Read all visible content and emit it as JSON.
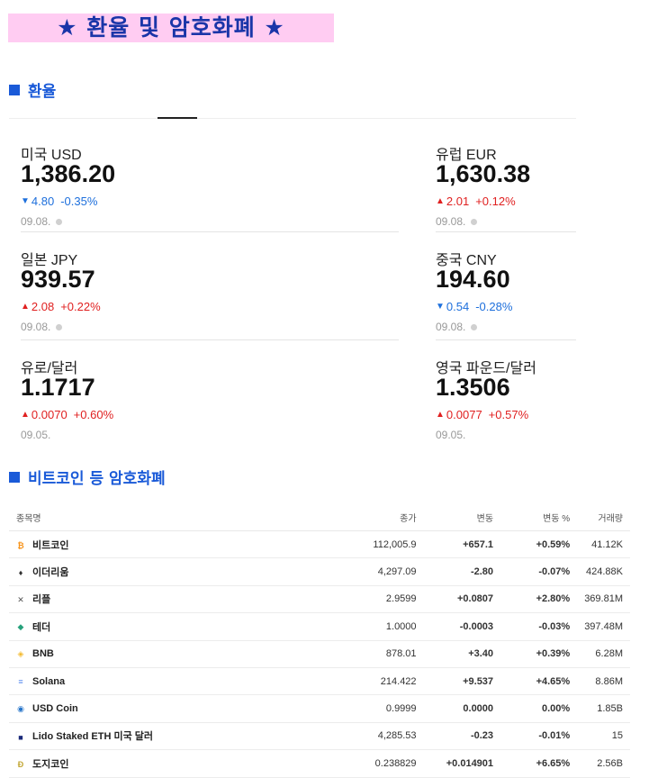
{
  "banner": {
    "title": "★  환율  및  암호화폐 ★"
  },
  "fx_section": {
    "title": "환율",
    "cards": [
      {
        "name": "미국 USD",
        "price": "1,386.20",
        "dir": "down",
        "arrow": "▼",
        "change": "4.80",
        "pct": "-0.35%",
        "date": "09.08.",
        "dot": true
      },
      {
        "name": "유럽 EUR",
        "price": "1,630.38",
        "dir": "up",
        "arrow": "▲",
        "change": "2.01",
        "pct": "+0.12%",
        "date": "09.08.",
        "dot": true
      },
      {
        "name": "일본 JPY",
        "price": "939.57",
        "dir": "up",
        "arrow": "▲",
        "change": "2.08",
        "pct": "+0.22%",
        "date": "09.08.",
        "dot": true
      },
      {
        "name": "중국 CNY",
        "price": "194.60",
        "dir": "down",
        "arrow": "▼",
        "change": "0.54",
        "pct": "-0.28%",
        "date": "09.08.",
        "dot": true
      },
      {
        "name": "유로/달러",
        "price": "1.1717",
        "dir": "up",
        "arrow": "▲",
        "change": "0.0070",
        "pct": "+0.60%",
        "date": "09.05.",
        "dot": false
      },
      {
        "name": "영국 파운드/달러",
        "price": "1.3506",
        "dir": "up",
        "arrow": "▲",
        "change": "0.0077",
        "pct": "+0.57%",
        "date": "09.05.",
        "dot": false
      }
    ]
  },
  "crypto_section": {
    "title": "비트코인 등 암호화폐",
    "columns": [
      "종목명",
      "종가",
      "변동",
      "변동 %",
      "거래량"
    ],
    "rows": [
      {
        "icon": "bitcoin-icon",
        "icon_char": "₿",
        "icon_color": "#f7931a",
        "name": "비트코인",
        "close": "112,005.9",
        "change": "+657.1",
        "pct": "+0.59%",
        "volume": "41.12K",
        "dir": "up"
      },
      {
        "icon": "ethereum-icon",
        "icon_char": "♦",
        "icon_color": "#333333",
        "name": "이더리움",
        "close": "4,297.09",
        "change": "-2.80",
        "pct": "-0.07%",
        "volume": "424.88K",
        "dir": "down"
      },
      {
        "icon": "ripple-icon",
        "icon_char": "✕",
        "icon_color": "#555555",
        "name": "리플",
        "close": "2.9599",
        "change": "+0.0807",
        "pct": "+2.80%",
        "volume": "369.81M",
        "dir": "up"
      },
      {
        "icon": "tether-icon",
        "icon_char": "◆",
        "icon_color": "#26a17b",
        "name": "테더",
        "close": "1.0000",
        "change": "-0.0003",
        "pct": "-0.03%",
        "volume": "397.48M",
        "dir": "down"
      },
      {
        "icon": "bnb-icon",
        "icon_char": "◈",
        "icon_color": "#f3ba2f",
        "name": "BNB",
        "close": "878.01",
        "change": "+3.40",
        "pct": "+0.39%",
        "volume": "6.28M",
        "dir": "up"
      },
      {
        "icon": "solana-icon",
        "icon_char": "≡",
        "icon_color": "#5b8def",
        "name": "Solana",
        "close": "214.422",
        "change": "+9.537",
        "pct": "+4.65%",
        "volume": "8.86M",
        "dir": "up"
      },
      {
        "icon": "usdcoin-icon",
        "icon_char": "◉",
        "icon_color": "#2775ca",
        "name": "USD Coin",
        "close": "0.9999",
        "change": "0.0000",
        "pct": "0.00%",
        "volume": "1.85B",
        "dir": "flat"
      },
      {
        "icon": "lido-steth-icon",
        "icon_char": "■",
        "icon_color": "#1b2a7a",
        "name": "Lido Staked ETH 미국 달러",
        "close": "4,285.53",
        "change": "-0.23",
        "pct": "-0.01%",
        "volume": "15",
        "dir": "down"
      },
      {
        "icon": "dogecoin-icon",
        "icon_char": "Ð",
        "icon_color": "#c2a633",
        "name": "도지코인",
        "close": "0.238829",
        "change": "+0.014901",
        "pct": "+6.65%",
        "volume": "2.56B",
        "dir": "up"
      }
    ]
  }
}
